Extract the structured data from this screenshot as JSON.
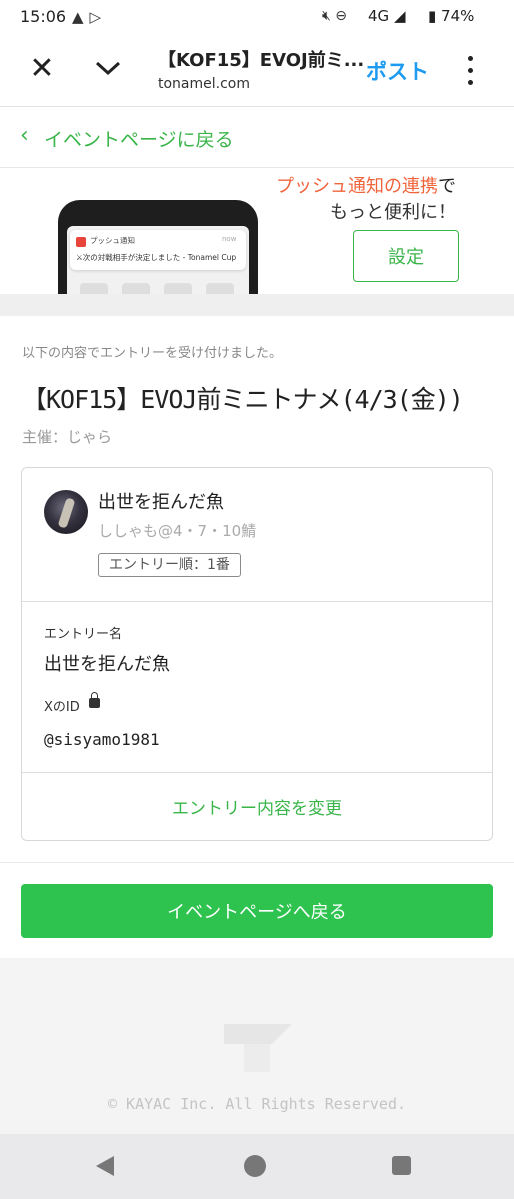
{
  "status_bar": {
    "time": "15:06",
    "network": "4G",
    "battery": "74%",
    "icons": [
      "warning-icon",
      "play-icon",
      "mute-icon",
      "dnd-icon",
      "signal-icon",
      "battery-icon"
    ]
  },
  "browser": {
    "title": "【KOF15】EVOJ前ミ...",
    "url": "tonamel.com",
    "post_label": "ポスト",
    "post_color": "#1d9bf0"
  },
  "back_link": {
    "label": "イベントページに戻る",
    "color": "#3ab54a"
  },
  "banner": {
    "highlight": "プッシュ通知の連携",
    "line1_rest": "で",
    "line2": "もっと便利に！",
    "settings_label": "設定",
    "notif_title": "プッシュ通知",
    "notif_time": "now",
    "notif_message": "⚔次の対戦相手が決定しました - Tonamel Cup"
  },
  "main": {
    "message": "以下の内容でエントリーを受け付けました。",
    "event_title": "【KOF15】EVOJ前ミニトナメ(4/3(金))",
    "organizer": "主催：じゃら"
  },
  "entry": {
    "player_name": "出世を拒んだ魚",
    "player_sub": "ししゃも@4・7・10鯖",
    "order_badge": "エントリー順：1番",
    "entry_name_label": "エントリー名",
    "entry_name_value": "出世を拒んだ魚",
    "xid_label": "XのID",
    "xid_value": "@sisyamo1981",
    "change_label": "エントリー内容を変更"
  },
  "return_button": {
    "label": "イベントページへ戻る",
    "color": "#2ec34f"
  },
  "footer": {
    "copyright": "© KAYAC Inc. All Rights Reserved."
  }
}
